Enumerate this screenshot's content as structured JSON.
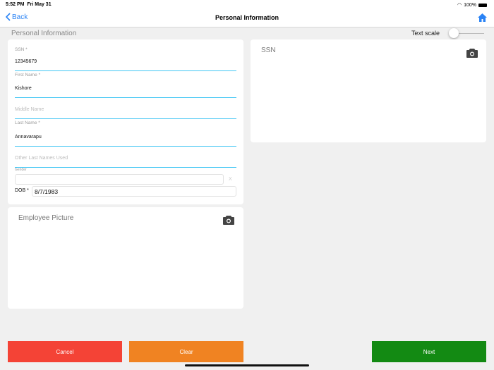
{
  "status": {
    "time": "5:52 PM",
    "date": "Fri May 31",
    "battery": "100%"
  },
  "nav": {
    "back": "Back",
    "title": "Personal Information"
  },
  "section_title": "Personal Information",
  "text_scale": {
    "label": "Text scale",
    "value": 0
  },
  "form": {
    "ssn": {
      "label": "SSN *",
      "value": "12345679"
    },
    "first_name": {
      "label": "First Name *",
      "value": "Kishore"
    },
    "middle_name": {
      "placeholder": "Middle Name"
    },
    "last_name": {
      "label": "Last Name *",
      "value": "Annavarapu"
    },
    "other_last_names": {
      "placeholder": "Other Last Names Used"
    },
    "gender": {
      "label": "Gender",
      "clear": "X"
    },
    "dob": {
      "label": "DOB *",
      "value": "8/7/1983"
    }
  },
  "employee_picture": {
    "title": "Employee Picture"
  },
  "ssn_card": {
    "title": "SSN"
  },
  "buttons": {
    "cancel": "Cancel",
    "clear": "Clear",
    "next": "Next"
  },
  "colors": {
    "cancel": "#f44336",
    "clear": "#f08322",
    "next": "#138a13",
    "accent": "#42c6f4"
  }
}
